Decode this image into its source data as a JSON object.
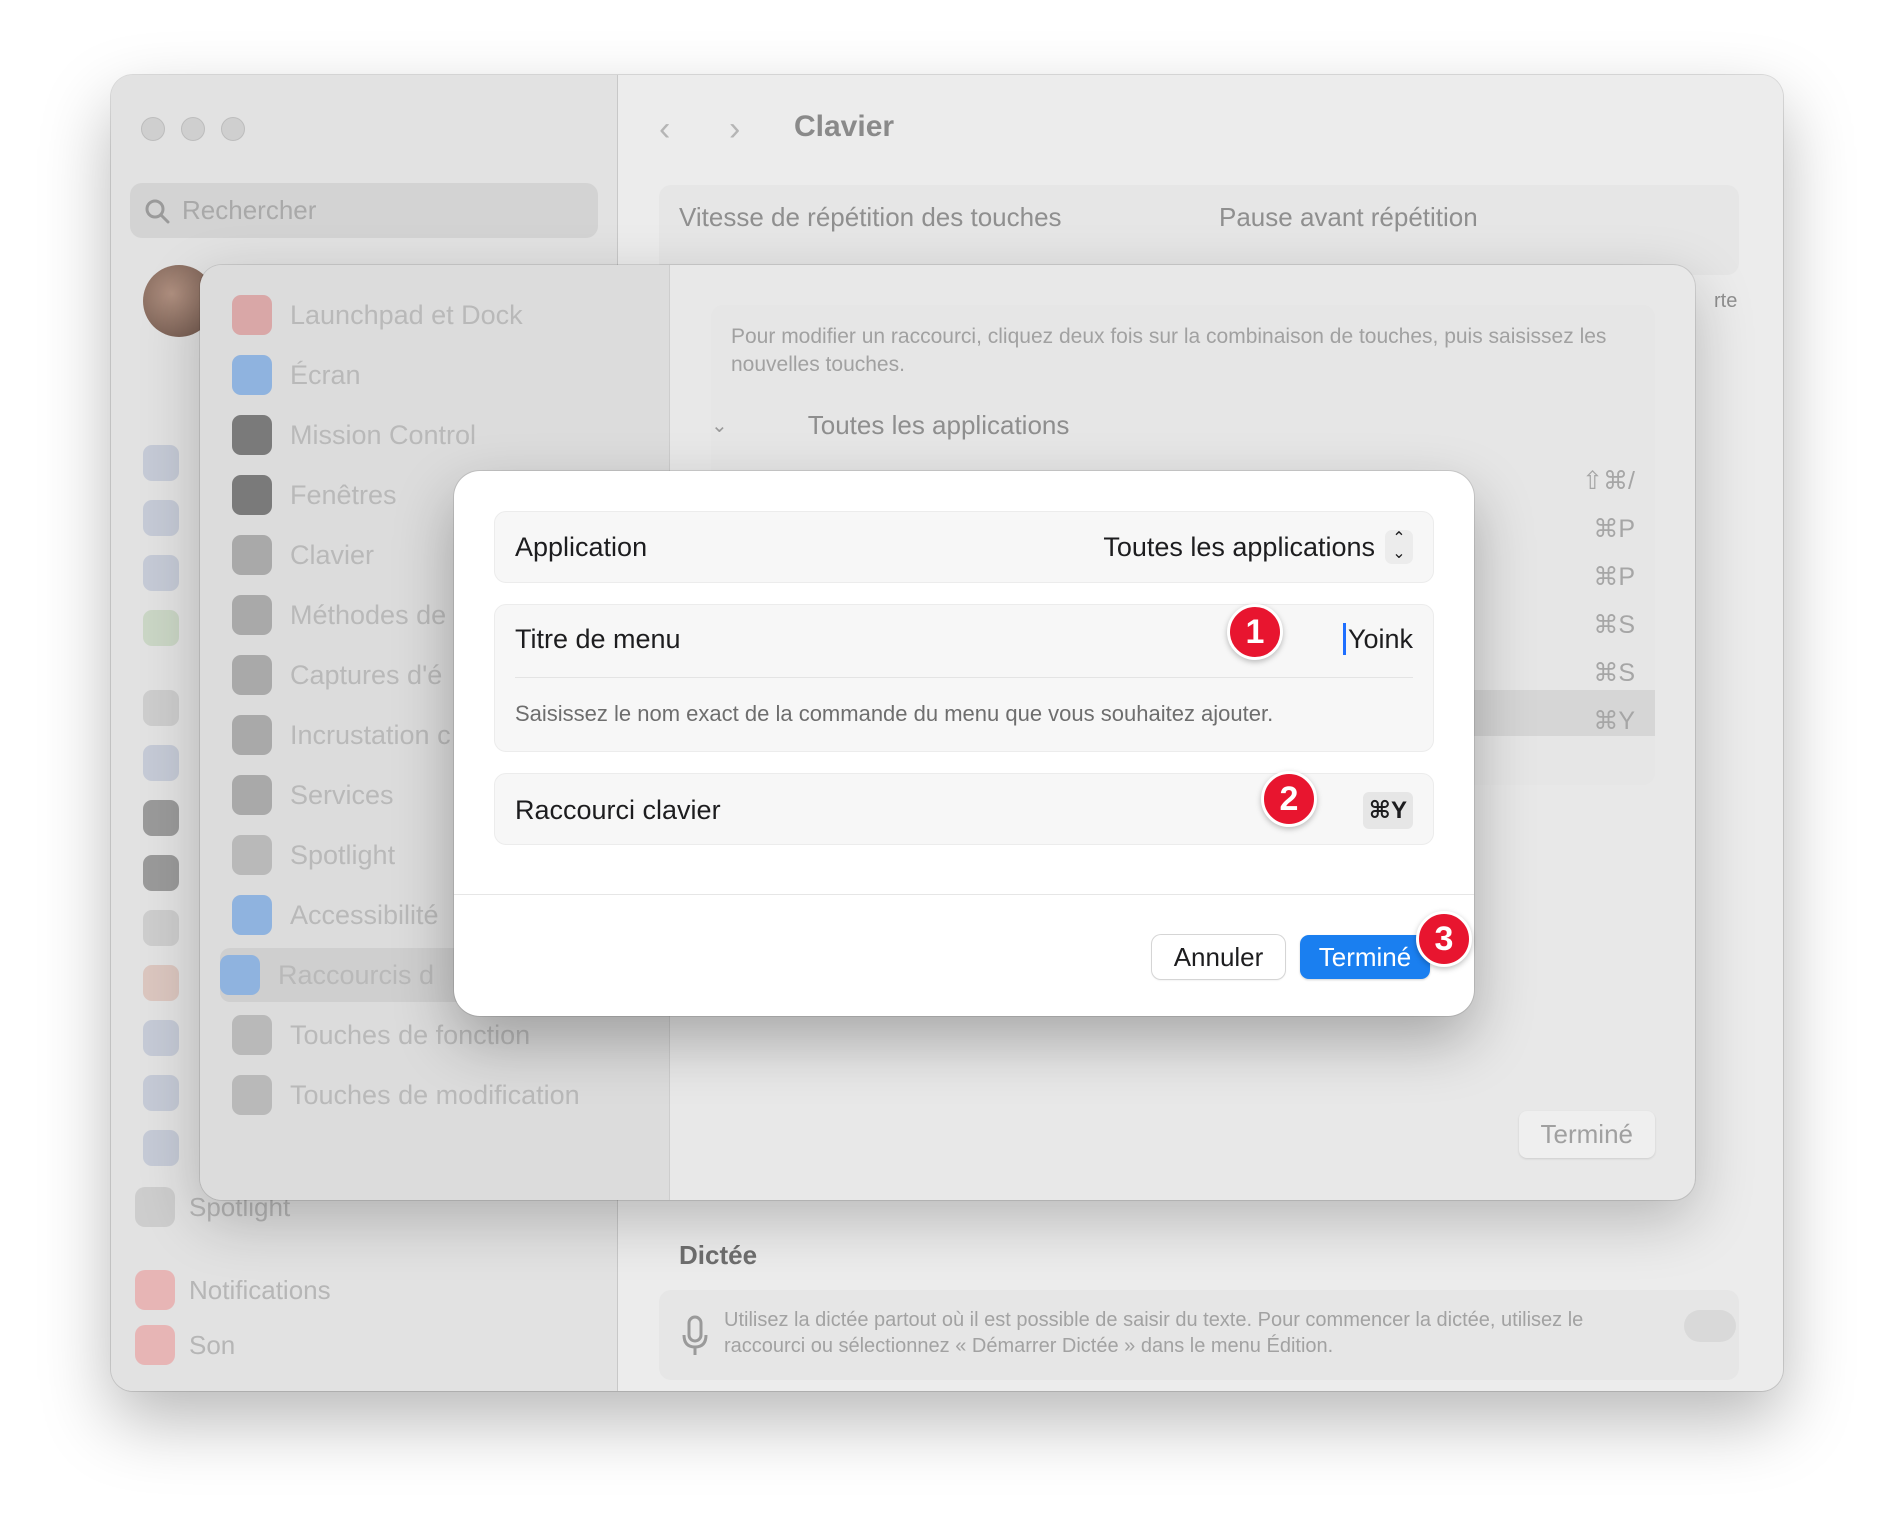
{
  "window": {
    "title": "Clavier",
    "search_placeholder": "Rechercher",
    "sidebar_bottom": [
      "Spotlight",
      "Notifications",
      "Son"
    ],
    "repeat_speed_label": "Vitesse de répétition des touches",
    "repeat_delay_label": "Pause avant répétition",
    "edge_fragment": "rte",
    "dictation_title": "Dictée",
    "dictation_text": "Utilisez la dictée partout où il est possible de saisir du texte. Pour commencer la dictée, utilisez le raccourci ou sélectionnez « Démarrer Dictée » dans le menu Édition."
  },
  "shortcuts_sheet": {
    "categories": [
      {
        "label": "Launchpad et Dock",
        "icon": "launchpad-icon"
      },
      {
        "label": "Écran",
        "icon": "display-icon"
      },
      {
        "label": "Mission Control",
        "icon": "mission-control-icon"
      },
      {
        "label": "Fenêtres",
        "icon": "windows-icon"
      },
      {
        "label": "Clavier",
        "icon": "keyboard-icon"
      },
      {
        "label": "Méthodes de",
        "icon": "input-methods-icon"
      },
      {
        "label": "Captures d'é",
        "icon": "screenshot-icon"
      },
      {
        "label": "Incrustation c",
        "icon": "picture-in-picture-icon"
      },
      {
        "label": "Services",
        "icon": "services-icon"
      },
      {
        "label": "Spotlight",
        "icon": "spotlight-icon"
      },
      {
        "label": "Accessibilité",
        "icon": "accessibility-icon"
      },
      {
        "label": "Raccourcis d",
        "icon": "app-shortcuts-icon"
      },
      {
        "label": "Touches de fonction",
        "icon": "fn-icon"
      },
      {
        "label": "Touches de modification",
        "icon": "modifier-keys-icon"
      }
    ],
    "hint": "Pour modifier un raccourci, cliquez deux fois sur la combinaison de touches, puis saisissez les nouvelles touches.",
    "group_label": "Toutes les applications",
    "shortcuts": [
      "⇧⌘/",
      "⌘P",
      "⌘P",
      "⌘S",
      "⌘S",
      "⌘Y"
    ],
    "done_label": "Terminé"
  },
  "dialog": {
    "application_label": "Application",
    "application_value": "Toutes les applications",
    "menu_title_label": "Titre de menu",
    "menu_title_value": "Yoink",
    "menu_title_help": "Saisissez le nom exact de la commande du menu que vous souhaitez ajouter.",
    "shortcut_label": "Raccourci clavier",
    "shortcut_value": "⌘Y",
    "cancel_label": "Annuler",
    "done_label": "Terminé"
  },
  "markers": [
    "1",
    "2",
    "3"
  ],
  "colors": {
    "accent": "#1a7ff0",
    "marker": "#e8152f",
    "caret": "#1f6fff"
  }
}
